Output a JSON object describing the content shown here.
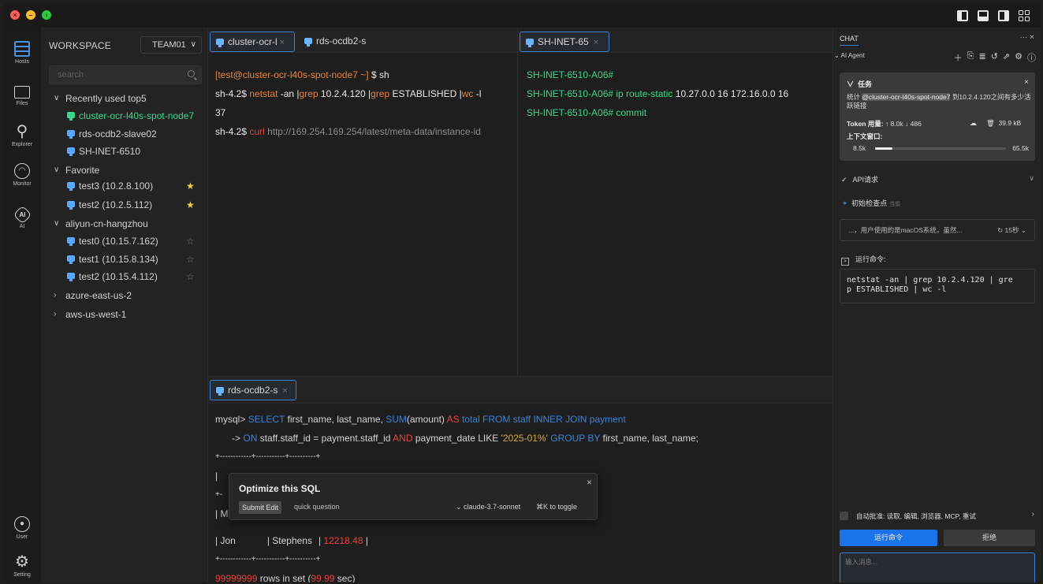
{
  "titlebar": {
    "buttons": [
      "close",
      "minimize",
      "zoom"
    ],
    "icons": [
      "layout-left-icon",
      "layout-bottom-icon",
      "layout-right-icon",
      "layout-grid-icon"
    ]
  },
  "activity": {
    "items": [
      {
        "label": "Hosts",
        "icon": "hosts-icon"
      },
      {
        "label": "Files",
        "icon": "folder-icon"
      },
      {
        "label": "Explorer",
        "icon": "search-icon"
      },
      {
        "label": "Monitor",
        "icon": "gauge-icon"
      },
      {
        "label": "AI",
        "icon": "ai-icon"
      },
      {
        "label": "User",
        "icon": "user-icon"
      },
      {
        "label": "Setting",
        "icon": "gear-icon"
      }
    ]
  },
  "sidebar": {
    "workspace_label": "WORKSPACE",
    "team": "TEAM01",
    "search_placeholder": "search",
    "groups": [
      {
        "label": "Recently used top5",
        "expanded": true,
        "items": [
          {
            "label": "cluster-ocr-l40s-spot-node7",
            "active": true
          },
          {
            "label": "rds-ocdb2-slave02"
          },
          {
            "label": "SH-INET-6510"
          }
        ]
      },
      {
        "label": "Favorite",
        "expanded": true,
        "items": [
          {
            "label": "test3  (10.2.8.100)",
            "star": "filled"
          },
          {
            "label": "test2  (10.2.5.112)",
            "star": "filled"
          }
        ]
      },
      {
        "label": "aliyun-cn-hangzhou",
        "expanded": true,
        "items": [
          {
            "label": "test0  (10.15.7.162)",
            "star": "empty"
          },
          {
            "label": "test1  (10.15.8.134)",
            "star": "empty"
          },
          {
            "label": "test2  (10.15.4.112)",
            "star": "empty"
          }
        ]
      },
      {
        "label": "azure-east-us-2",
        "expanded": false
      },
      {
        "label": "aws-us-west-1",
        "expanded": false
      }
    ]
  },
  "pane1": {
    "tabs": [
      "cluster-ocr-l",
      "rds-ocdb2-s"
    ],
    "prompt": "[test@cluster-ocr-l40s-spot-node7 ~]",
    "prompt_cmd": "$ sh",
    "l2_prompt": "sh-4.2$",
    "l2_cmd": "netstat",
    "l2_rest1": "-an |",
    "l2_grep1": "grep",
    "l2_rest2": "10.2.4.120 |",
    "l2_grep2": "grep",
    "l2_rest3": "ESTABLISHED |",
    "l2_wc": "wc",
    "l2_rest4": "-l",
    "l3": "37",
    "l4_prompt": "sh-4.2$",
    "l4_cmd": "curl",
    "l4_url": "http://169.254.169.254/latest/meta-data/instance-id"
  },
  "pane2": {
    "tab": "SH-INET-65",
    "l1": "SH-INET-6510-A06#",
    "l2_a": "SH-INET-6510-A06# ip route-static",
    "l2_b": "10.27.0.0 16 172.16.0.0 16",
    "l3": "SH-INET-6510-A06# commit"
  },
  "pane3": {
    "tab": "rds-ocdb2-s",
    "q1": {
      "prompt": "mysql>",
      "select": "SELECT",
      "cols": "first_name, last_name,",
      "sum": "SUM",
      "amount": "(amount)",
      "as": "AS",
      "rest": "total FROM staff INNER JOIN payment"
    },
    "q2": {
      "arrow": "->",
      "on": "ON",
      "cond": "staff.staff_id = payment.staff_id",
      "and": "AND",
      "pd": "payment_date LIKE",
      "str": "'2025-01%'",
      "group": "GROUP BY",
      "tail": "first_name, last_name;"
    },
    "border": "+------------+-----------+----------+",
    "row_partial": "| Mike        | Hillyer      | 11899.56 |",
    "row_jon_first": "| Jon",
    "row_jon_last": "| Stephens",
    "row_jon_val": "12218.48",
    "row_jon_end": "|",
    "footer_count": "99999999",
    "footer_mid": "rows in set (",
    "footer_time": "99.99",
    "footer_end": "sec)"
  },
  "popup": {
    "title": "Optimize this SQL",
    "submit": "Submit Edit",
    "quick": "quick question",
    "model": "claude-3.7-sonnet",
    "toggle": "⌘K to toggle"
  },
  "chat": {
    "title": "CHAT",
    "agent": "AI Agent",
    "task_title": "任务",
    "task_text_a": "统计",
    "task_mention": "@cluster-ocr-l40s-spot-node7",
    "task_text_b": "到10.2.4.120之间有多少活跃链接",
    "token_label": "Token 用量:",
    "token_values": "↑ 8.0k ↓ 486",
    "size": "39.9 kB",
    "context_label": "上下文窗口:",
    "context_used": "8.5k",
    "context_max": "65.5k",
    "context_fraction": 0.13,
    "api_label": "API请求",
    "checkpoint_label": "初始检查点",
    "checkpoint_dim": "当前",
    "thought": "...，用户使用的是macOS系统，虽然...",
    "thought_timer": "15秒",
    "run_label": "运行命令:",
    "command": "netstat -an | grep 10.2.4.120 | gre\np ESTABLISHED | wc -l",
    "auto_approve": "自动批准: 读取, 编辑, 浏览器, MCP, 重试",
    "run_button": "运行命令",
    "reject_button": "拒绝",
    "input_placeholder": "输入消息..."
  }
}
